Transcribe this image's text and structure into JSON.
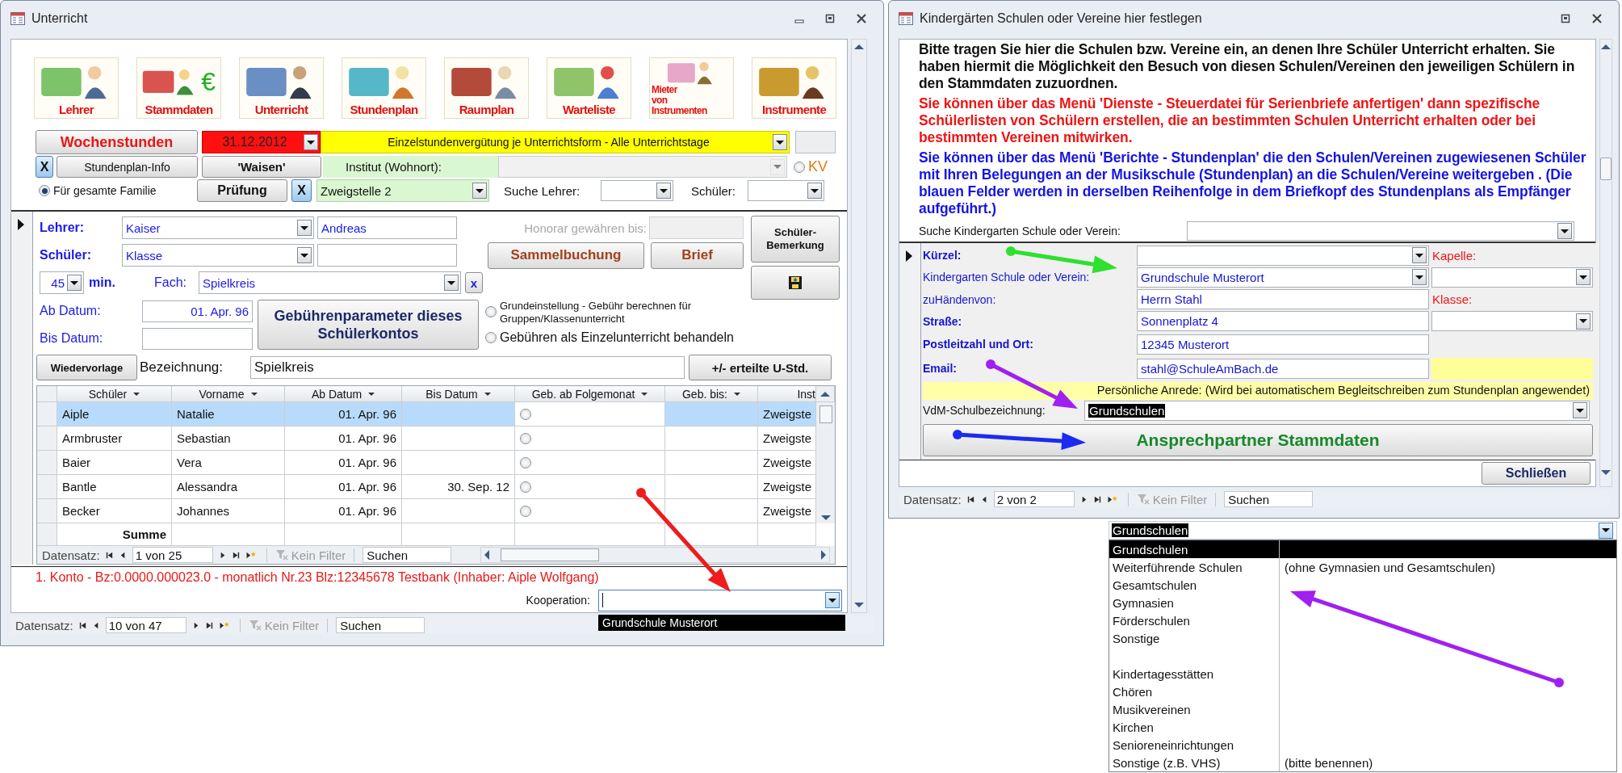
{
  "unterricht": {
    "title": "Unterricht",
    "toolbar": [
      {
        "label": [
          "Lehrer"
        ]
      },
      {
        "label": [
          "Stammdaten"
        ],
        "symbol": "€"
      },
      {
        "label": [
          "Unterricht"
        ]
      },
      {
        "label": [
          "Stundenplan"
        ]
      },
      {
        "label": [
          "Raumplan"
        ]
      },
      {
        "label": [
          "Warteliste"
        ]
      },
      {
        "label": [
          "Mieter",
          "von",
          "Instrumenten"
        ]
      },
      {
        "label": [
          "Instrumente"
        ]
      }
    ],
    "wochenstunden_button": "Wochenstunden",
    "date_field": "31.12.2012",
    "verguetung_field": "Einzelstundenvergütung je Unterrichtsform - Alle Unterrichtstage",
    "x_button": "X",
    "stundenplan_info_button": "Stundenplan-Info",
    "waisen_button": "'Waisen'",
    "institut_label": "Institut (Wohnort):",
    "kv_option": {
      "label": "KV",
      "selected": false
    },
    "familie_option": {
      "label": "Für gesamte Familie",
      "selected": true
    },
    "pruefung_button": "Prüfung",
    "x_button_2": "X",
    "zweigstelle_field": "Zweigstelle 2",
    "suche_lehrer_label": "Suche Lehrer:",
    "schueler_search_label": "Schüler:",
    "record": {
      "lehrer_label": "Lehrer:",
      "lehrer_last": "Kaiser",
      "lehrer_first": "Andreas",
      "honorar_label": "Honorar gewähren bis:",
      "bemerkung_button": "Schüler-Bemerkung",
      "schueler_label": "Schüler:",
      "schueler_value": "Klasse",
      "sammelbuchung_button": "Sammelbuchung",
      "brief_button": "Brief",
      "minutes": "45",
      "min_label": "min.",
      "fach_label": "Fach:",
      "fach_value": "Spielkreis",
      "fach_clear": "x",
      "ab_label": "Ab Datum:",
      "ab_value": "01. Apr. 96",
      "bis_label": "Bis Datum:",
      "gebuehren_button": "Gebührenparameter dieses Schülerkontos",
      "fee_options": [
        {
          "label": "Grundeinstellung - Gebühr berechnen für Gruppen/Klassenunterricht",
          "kind": "small",
          "selected": false
        },
        {
          "label": "Gebühren als Einzelunterricht behandeln",
          "kind": "large",
          "selected": false
        }
      ],
      "wiedervorlage_button": "Wiedervorlage",
      "bezeichnung_label": "Bezeichnung:",
      "bezeichnung_value": "Spielkreis",
      "erteilte_button": "+/- erteilte U-Std."
    },
    "table": {
      "columns": [
        "Schüler",
        "Vorname",
        "Ab Datum",
        "Bis Datum",
        "Geb. ab Folgemonat",
        "Geb. bis:",
        "Inst"
      ],
      "rows": [
        {
          "schueler": "Aiple",
          "vorname": "Natalie",
          "ab": "01. Apr. 96",
          "folgemonat": false,
          "inst": "Zweigste",
          "selected": true
        },
        {
          "schueler": "Armbruster",
          "vorname": "Sebastian",
          "ab": "01. Apr. 96",
          "folgemonat": false,
          "inst": "Zweigste",
          "selected": false
        },
        {
          "schueler": "Baier",
          "vorname": "Vera",
          "ab": "01. Apr. 96",
          "folgemonat": false,
          "inst": "Zweigste",
          "selected": false
        },
        {
          "schueler": "Bantle",
          "vorname": "Alessandra",
          "ab": "01. Apr. 96",
          "bis": "30. Sep. 12",
          "folgemonat": false,
          "inst": "Zweigste",
          "selected": false
        },
        {
          "schueler": "Becker",
          "vorname": "Johannes",
          "ab": "01. Apr. 96",
          "folgemonat": false,
          "inst": "Zweigste",
          "selected": false
        }
      ],
      "sum_label": "Summe",
      "nav": {
        "label": "Datensatz:",
        "position": "1 von 25",
        "filter": "Kein Filter",
        "search": "Suchen"
      }
    },
    "konto_text": "1. Konto - Bz:0.0000.000023.0 - monatlich Nr.23 Blz:12345678 Testbank (Inhaber: Aiple Wolfgang)",
    "kooperation_label": "Kooperation:",
    "kooperation_option": "Grundschule Musterort",
    "nav": {
      "label": "Datensatz:",
      "position": "10 von 47",
      "filter": "Kein Filter",
      "search": "Suchen"
    }
  },
  "kindergarten": {
    "title": "Kindergärten Schulen oder Vereine hier festlegen",
    "info_paragraphs": [
      {
        "kind": "note",
        "text": "Bitte tragen Sie hier die Schulen bzw. Vereine ein, an denen Ihre Schüler Unterricht erhalten. Sie haben hiermit die Möglichkeit den Besuch von diesen Schulen/Vereinen den jeweiligen Schülern in den Stammdaten zuzuordnen."
      },
      {
        "kind": "warning",
        "text": "Sie können über das Menü 'Dienste - Steuerdatei für Serienbriefe anfertigen' dann spezifische Schülerlisten von Schülern erstellen, die an bestimmten Schulen Unterricht erhalten oder bei bestimmten Vereinen mitwirken."
      },
      {
        "kind": "hint",
        "text": "Sie können über das Menü 'Berichte - Stundenplan' die den Schulen/Vereinen zugewiesenen Schüler mit Ihren Belegungen an der Musikschule (Stundenplan) an die Schulen/Vereine weitergeben . (Die blauen Felder werden in derselben Reihenfolge in dem Briefkopf des Stundenplans als Empfänger aufgeführt.)"
      }
    ],
    "search_label": "Suche Kindergarten Schule oder Verein:",
    "kuerzel_label": "Kürzel:",
    "kapelle_label": "Kapelle:",
    "verein_label": "Kindergarten Schule oder Verein:",
    "verein_value": "Grundschule Musterort",
    "zuhaenden_label": "zuHändenvon:",
    "zuhaenden_value": "Herrn Stahl",
    "klasse_label": "Klasse:",
    "strasse_label": "Straße:",
    "strasse_value": "Sonnenplatz 4",
    "plz_label": "Postleitzahl und Ort:",
    "plz_value": "12345 Musterort",
    "email_label": "Email:",
    "email_value": "stahl@SchuleAmBach.de",
    "anrede_text": "Persönliche Anrede: (Wird bei automatischem Begleitschreiben zum Stundenplan angewendet)",
    "vdm_label": "VdM-Schulbezeichnung:",
    "vdm_value": "Grundschulen",
    "stammdaten_button": "Ansprechpartner Stammdaten",
    "close_button": "Schließen",
    "nav": {
      "label": "Datensatz:",
      "position": "2 von 2",
      "filter": "Kein Filter",
      "search": "Suchen"
    }
  },
  "vdm_dropdown": {
    "value": "Grundschulen",
    "options": [
      {
        "kind": "option",
        "name": "Grundschulen",
        "selected": true
      },
      {
        "kind": "option",
        "name": "Weiterführende Schulen",
        "note": "(ohne Gymnasien und Gesamtschulen)",
        "selected": false
      },
      {
        "kind": "option",
        "name": "Gesamtschulen",
        "selected": false
      },
      {
        "kind": "option",
        "name": "Gymnasien",
        "selected": false
      },
      {
        "kind": "option",
        "name": "Förderschulen",
        "selected": false
      },
      {
        "kind": "option",
        "name": "Sonstige",
        "selected": false
      },
      {
        "kind": "blank",
        "selected": false
      },
      {
        "kind": "option",
        "name": "Kindertagesstätten",
        "selected": false
      },
      {
        "kind": "option",
        "name": "Chören",
        "selected": false
      },
      {
        "kind": "option",
        "name": "Musikvereinen",
        "selected": false
      },
      {
        "kind": "option",
        "name": "Kirchen",
        "selected": false
      },
      {
        "kind": "option",
        "name": "Senioreneinrichtungen",
        "selected": false
      },
      {
        "kind": "option",
        "name": "Sonstige (z.B. VHS)",
        "note": "(bitte benennen)",
        "selected": false
      }
    ]
  }
}
